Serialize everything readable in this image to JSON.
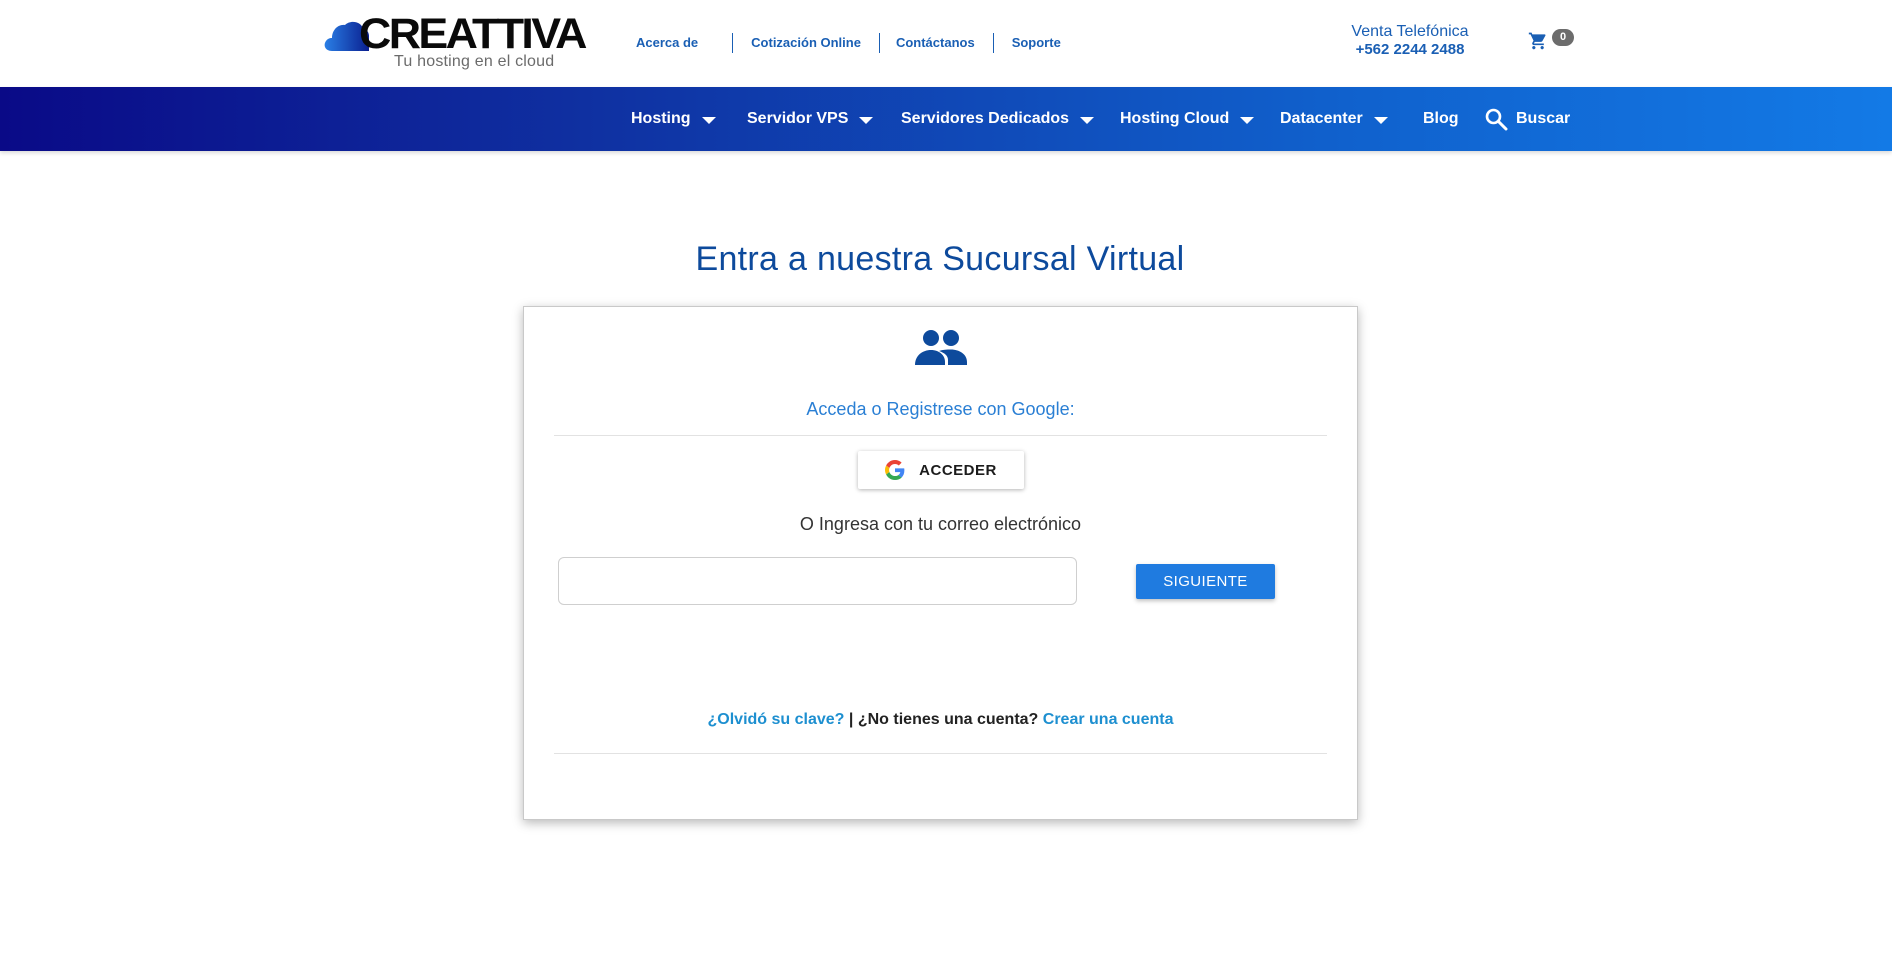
{
  "logo": {
    "wordmark": "CREATTIVA",
    "tagline": "Tu hosting en el cloud"
  },
  "top_nav": [
    "Acerca de",
    "Cotización Online",
    "Contáctanos",
    "Soporte"
  ],
  "phone": {
    "label": "Venta Telefónica",
    "number": "+562 2244 2488"
  },
  "cart": {
    "count": "0",
    "icon": "cart-icon"
  },
  "main_nav": {
    "items": [
      {
        "label": "Hosting",
        "dropdown": true
      },
      {
        "label": "Servidor VPS",
        "dropdown": true
      },
      {
        "label": "Servidores Dedicados",
        "dropdown": true
      },
      {
        "label": "Hosting Cloud",
        "dropdown": true
      },
      {
        "label": "Datacenter",
        "dropdown": true
      },
      {
        "label": "Blog",
        "dropdown": false
      }
    ],
    "search_label": "Buscar"
  },
  "login": {
    "title": "Entra a nuestra Sucursal Virtual",
    "google_prompt": "Acceda o Registrese con Google:",
    "google_button": "ACCEDER",
    "email_prompt": "O Ingresa con tu correo electrónico",
    "email_value": "",
    "email_placeholder": "",
    "next_button": "SIGUIENTE",
    "forgot_link": "¿Olvidó su clave?",
    "separator": "|",
    "no_account_text": "¿No tienes una cuenta?",
    "create_account_link": "Crear una cuenta"
  },
  "colors": {
    "brand_blue": "#1a5fb4",
    "nav_gradient_start": "#0a0a87",
    "nav_gradient_end": "#137ae6",
    "title_blue": "#0d4a9c",
    "button_blue": "#1f7be0",
    "link_blue": "#1d8fd0"
  }
}
